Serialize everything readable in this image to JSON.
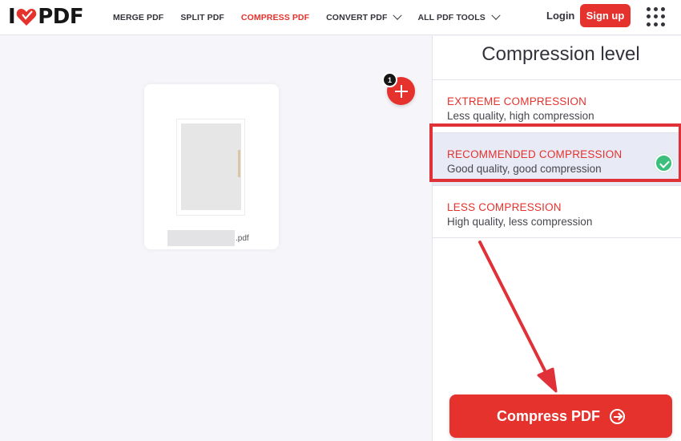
{
  "header": {
    "logo_text_left": "I",
    "logo_text_right": "PDF",
    "nav": [
      {
        "label": "MERGE PDF",
        "active": false,
        "dropdown": false
      },
      {
        "label": "SPLIT PDF",
        "active": false,
        "dropdown": false
      },
      {
        "label": "COMPRESS PDF",
        "active": true,
        "dropdown": false
      },
      {
        "label": "CONVERT PDF",
        "active": false,
        "dropdown": true
      },
      {
        "label": "ALL PDF TOOLS",
        "active": false,
        "dropdown": true
      }
    ],
    "login_label": "Login",
    "signup_label": "Sign up"
  },
  "workspace": {
    "file_count": "1",
    "file_extension": ".pdf"
  },
  "sidebar": {
    "title": "Compression level",
    "options": [
      {
        "title": "EXTREME COMPRESSION",
        "description": "Less quality, high compression",
        "selected": false
      },
      {
        "title": "RECOMMENDED COMPRESSION",
        "description": "Good quality, good compression",
        "selected": true
      },
      {
        "title": "LESS COMPRESSION",
        "description": "High quality, less compression",
        "selected": false
      }
    ],
    "compress_button_label": "Compress PDF"
  },
  "colors": {
    "brand_red": "#e5322d",
    "selected_bg": "#e8eaf6",
    "check_green": "#3ac07c",
    "annotation_red": "#e03038"
  },
  "icons": [
    "heart-icon",
    "chevron-down-icon",
    "apps-grid-icon",
    "plus-icon",
    "check-icon",
    "arrow-right-circle-icon"
  ]
}
